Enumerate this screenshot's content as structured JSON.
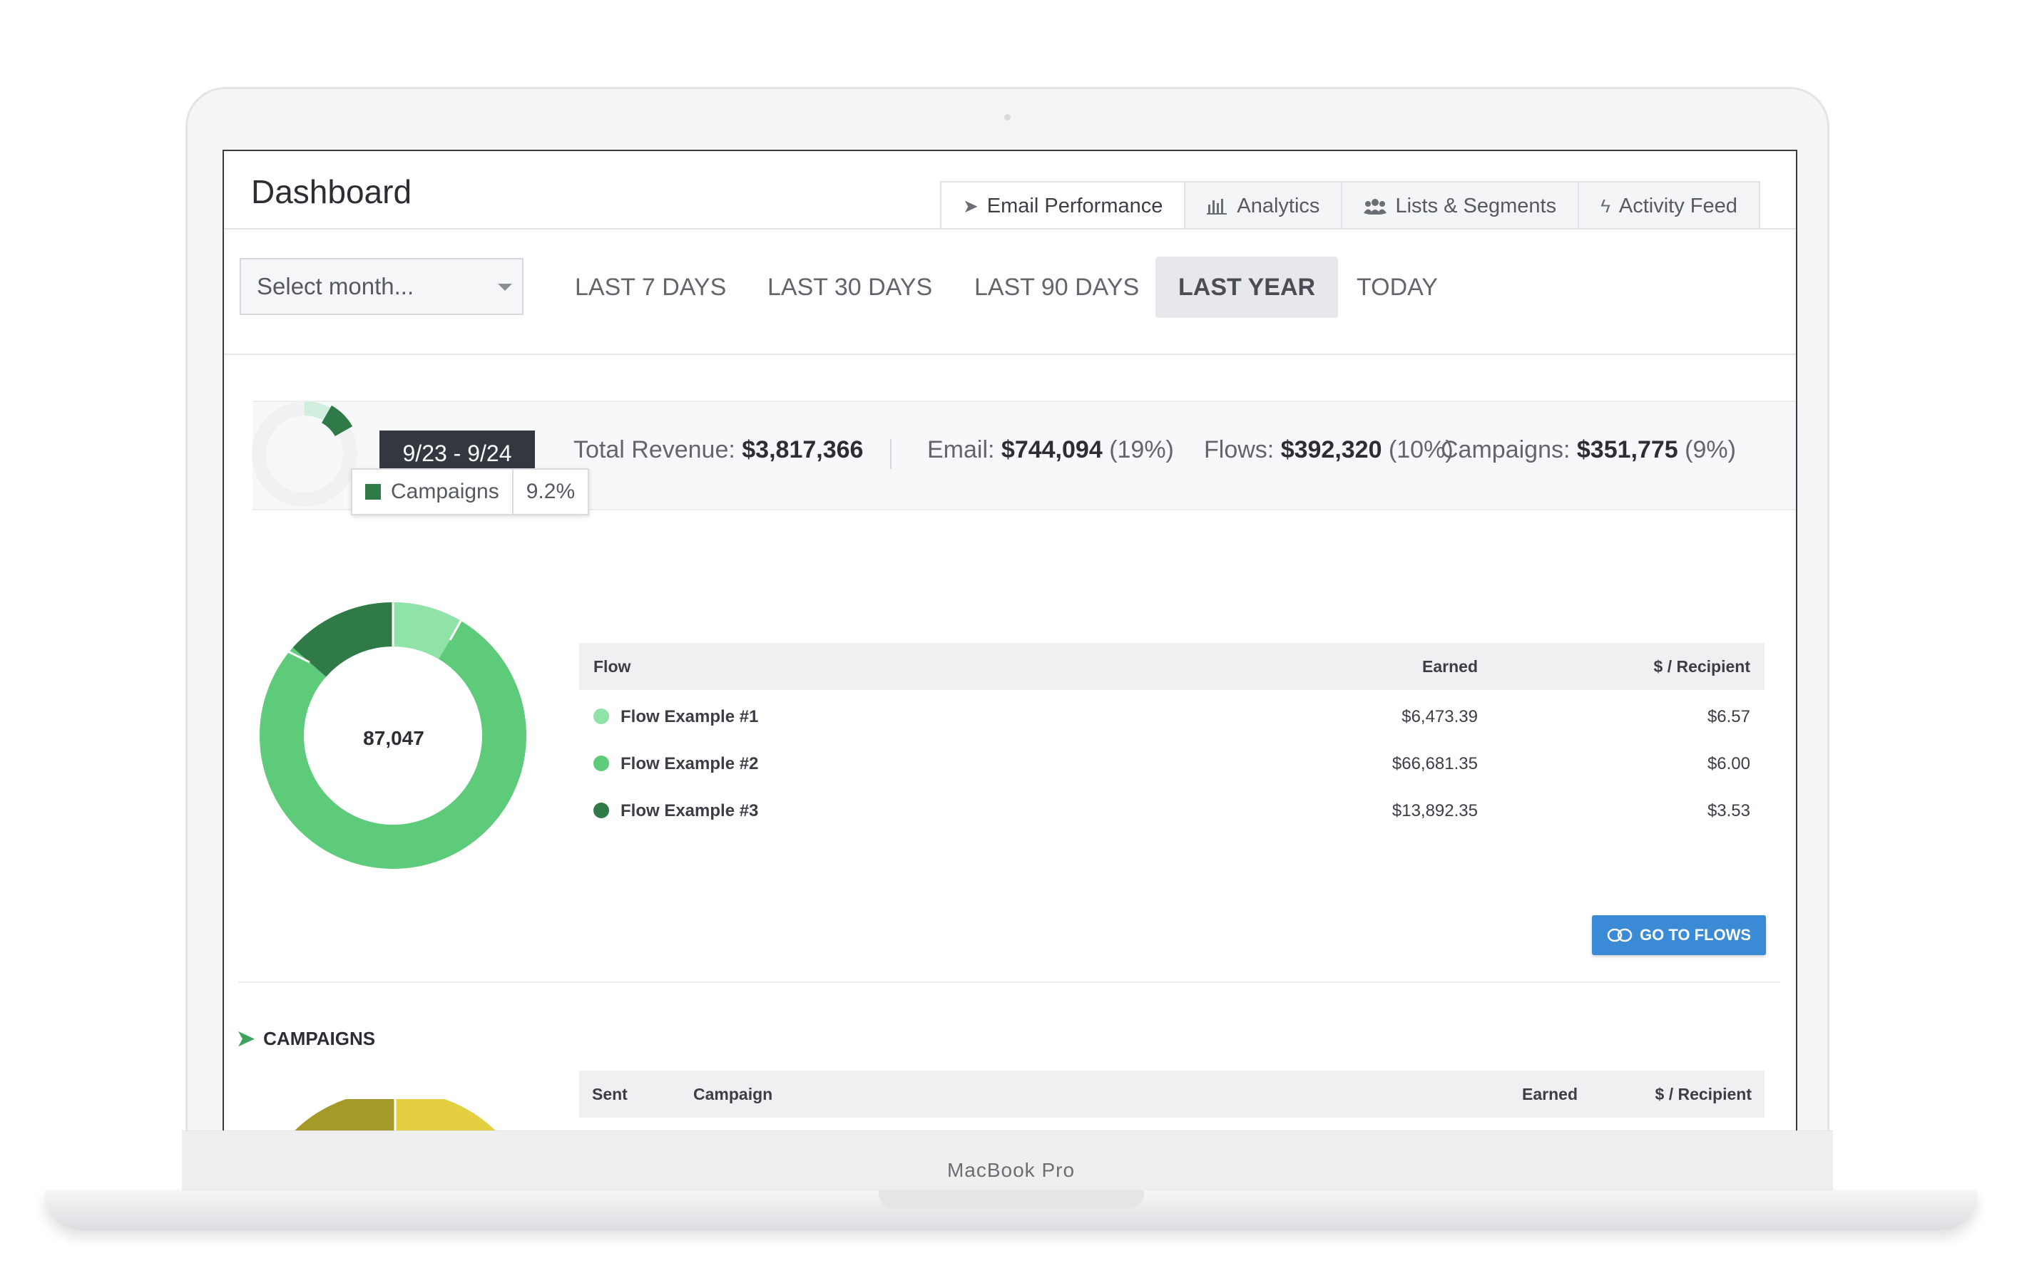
{
  "device": {
    "label": "MacBook Pro"
  },
  "header": {
    "title": "Dashboard"
  },
  "tabs": [
    {
      "label": "Email Performance",
      "icon": "paper-plane-icon",
      "active": true
    },
    {
      "label": "Analytics",
      "icon": "bar-chart-icon",
      "active": false
    },
    {
      "label": "Lists & Segments",
      "icon": "users-icon",
      "active": false
    },
    {
      "label": "Activity Feed",
      "icon": "bolt-icon",
      "active": false
    }
  ],
  "filters": {
    "month_placeholder": "Select month...",
    "ranges": [
      {
        "label": "LAST 7 DAYS",
        "active": false
      },
      {
        "label": "LAST 30 DAYS",
        "active": false
      },
      {
        "label": "LAST 90 DAYS",
        "active": false
      },
      {
        "label": "LAST YEAR",
        "active": true
      },
      {
        "label": "TODAY",
        "active": false
      }
    ]
  },
  "summary": {
    "date_range": "9/23 - 9/24",
    "tooltip": {
      "label": "Campaigns",
      "value": "9.2%"
    },
    "total_revenue_label": "Total Revenue:",
    "total_revenue": "$3,817,366",
    "email_label": "Email:",
    "email_value": "$744,094",
    "email_pct": "(19%)",
    "flows_label": "Flows:",
    "flows_value": "$392,320",
    "flows_pct": "(10%)",
    "campaigns_label": "Campaigns:",
    "campaigns_value": "$351,775",
    "campaigns_pct": "(9%)"
  },
  "flows": {
    "donut_center": "87,047",
    "columns": {
      "flow": "Flow",
      "earned": "Earned",
      "per_recipient": "$ / Recipient"
    },
    "rows": [
      {
        "name": "Flow Example #1",
        "earned": "$6,473.39",
        "per_recipient": "$6.57",
        "color": "#8fe3a8"
      },
      {
        "name": "Flow Example #2",
        "earned": "$66,681.35",
        "per_recipient": "$6.00",
        "color": "#5ecb7b"
      },
      {
        "name": "Flow Example #3",
        "earned": "$13,892.35",
        "per_recipient": "$3.53",
        "color": "#2f7a46"
      }
    ],
    "button_label": "GO TO FLOWS"
  },
  "campaigns": {
    "title": "CAMPAIGNS",
    "columns": {
      "sent": "Sent",
      "campaign": "Campaign",
      "earned": "Earned",
      "per_recipient": "$ / Recipient"
    }
  },
  "colors": {
    "accent": "#3a8ad6",
    "flow_light": "#8fe3a8",
    "flow_main": "#5ecb7b",
    "flow_dark": "#2f7a46",
    "camp_olive": "#a39a2a",
    "camp_yellow": "#e3cf3f"
  }
}
